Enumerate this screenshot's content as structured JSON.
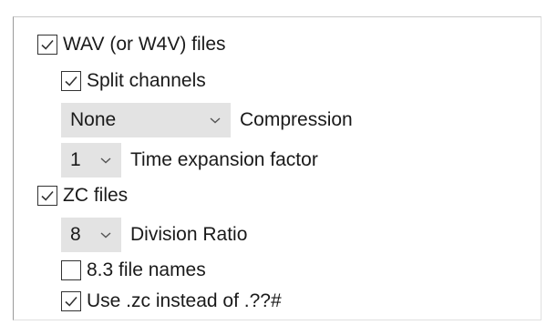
{
  "wav": {
    "label": "WAV (or W4V) files",
    "checked": true,
    "split_channels": {
      "label": "Split channels",
      "checked": true
    },
    "compression": {
      "value": "None",
      "label": "Compression"
    },
    "time_expansion": {
      "value": "1",
      "label": "Time expansion factor"
    }
  },
  "zc": {
    "label": "ZC files",
    "checked": true,
    "division_ratio": {
      "value": "8",
      "label": "Division Ratio"
    },
    "file_names_83": {
      "label": "8.3 file names",
      "checked": false
    },
    "use_zc": {
      "label": "Use .zc instead of .??#",
      "checked": true
    }
  },
  "colors": {
    "combo_bg": "#e3e3e3",
    "checkbox_border": "#333333",
    "text": "#1a1a1a"
  }
}
